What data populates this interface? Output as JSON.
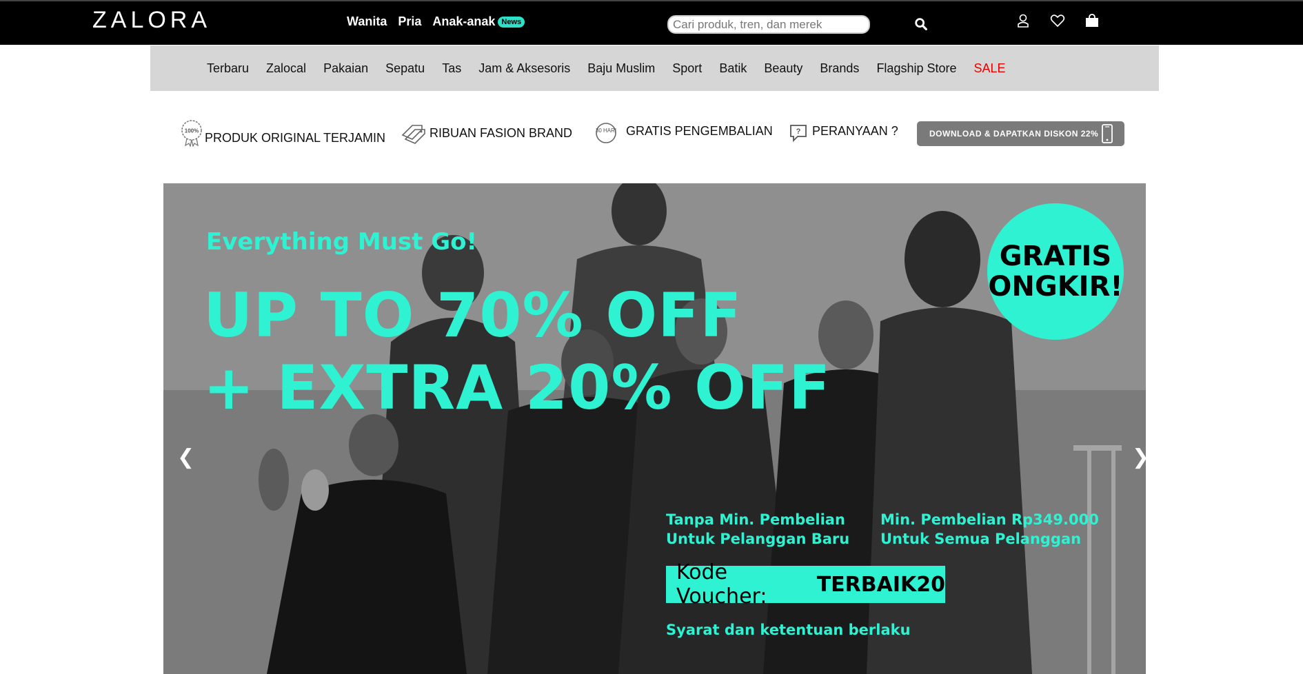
{
  "header": {
    "logo": "ZALORA",
    "gender_nav": [
      {
        "label": "Wanita"
      },
      {
        "label": "Pria"
      },
      {
        "label": "Anak-anak"
      }
    ],
    "news_badge": "News",
    "search": {
      "placeholder": "Cari produk, tren, dan merek",
      "value": ""
    }
  },
  "categories": [
    "Terbaru",
    "Zalocal",
    "Pakaian",
    "Sepatu",
    "Tas",
    "Jam & Aksesoris",
    "Baju Muslim",
    "Sport",
    "Batik",
    "Beauty",
    "Brands",
    "Flagship Store",
    "SALE"
  ],
  "usp": {
    "original": "PRODUK ORIGINAL TERJAMIN",
    "original_badge": "100%",
    "brands": "RIBUAN FASION BRAND",
    "returns": "GRATIS PENGEMBALIAN",
    "returns_badge": "30 HARI",
    "questions": "PERANYAAN ?",
    "download": "DOWNLOAD & DAPATKAN DISKON 22%"
  },
  "hero": {
    "tagline": "Everything Must Go!",
    "headline1": "UP TO 70% OFF",
    "headline2": "+ EXTRA 20% OFF",
    "circle_line1": "GRATIS",
    "circle_line2": "ONGKIR!",
    "cond1_line1": "Tanpa Min. Pembelian",
    "cond1_line2": "Untuk Pelanggan Baru",
    "cond2_line1": "Min. Pembelian Rp349.000",
    "cond2_line2": "Untuk Semua Pelanggan",
    "voucher_label": "Kode Voucher:",
    "voucher_code": "TERBAIK20",
    "terms": "Syarat dan ketentuan berlaku",
    "prev_arrow": "❮",
    "next_arrow": "❯"
  },
  "colors": {
    "accent": "#2ef2d2",
    "sale": "#e60000",
    "topbar": "#000000",
    "catnav": "#d6d6d6"
  }
}
